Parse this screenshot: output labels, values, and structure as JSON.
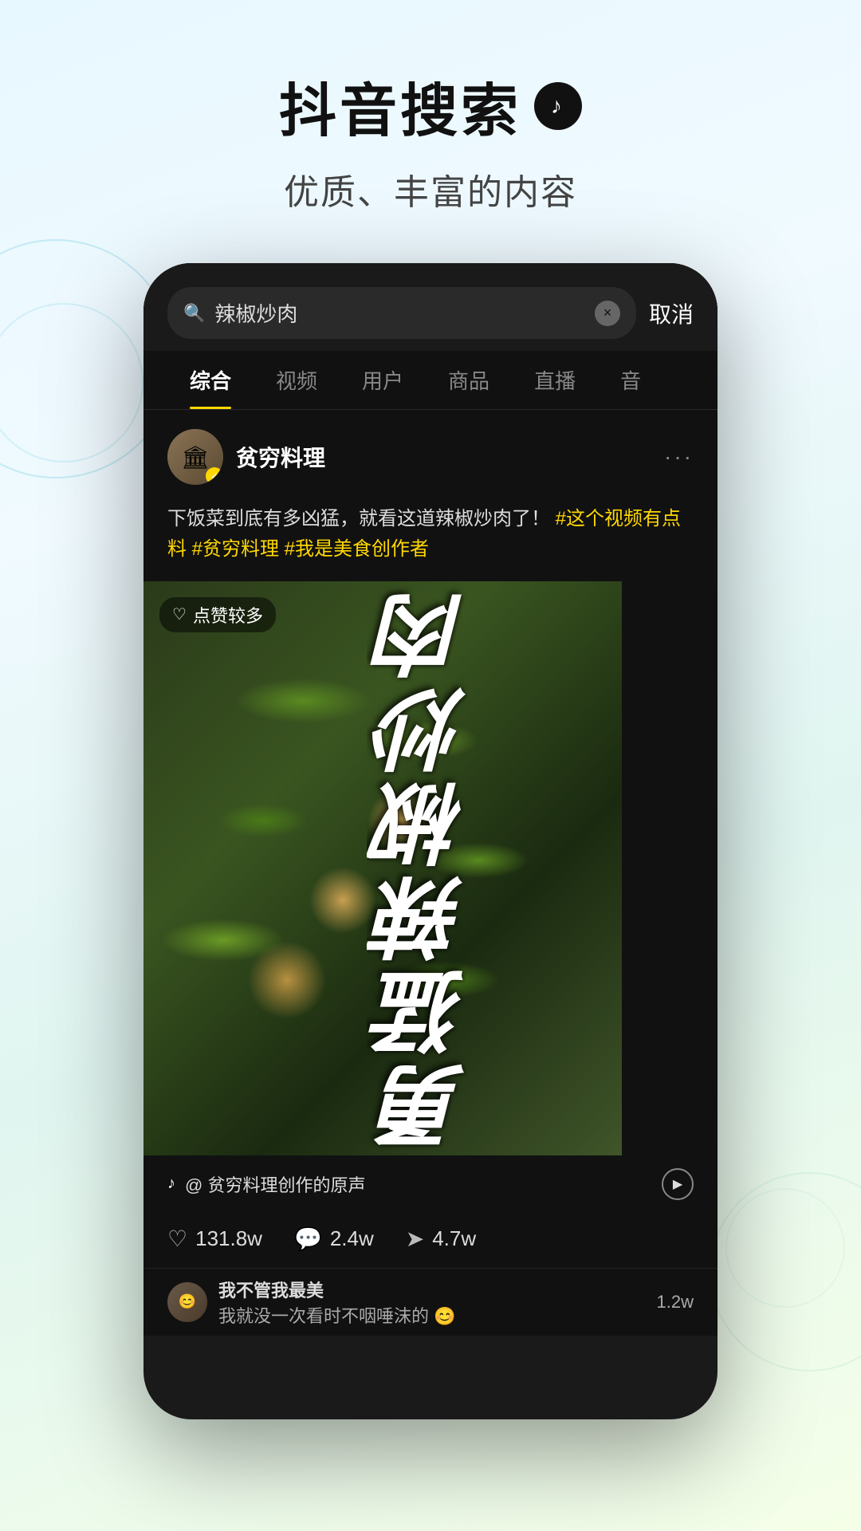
{
  "header": {
    "title": "抖音搜索",
    "logo_symbol": "♪",
    "subtitle": "优质、丰富的内容"
  },
  "phone": {
    "search": {
      "query": "辣椒炒肉",
      "cancel_label": "取消",
      "clear_symbol": "×",
      "search_symbol": "🔍"
    },
    "tabs": [
      {
        "label": "综合",
        "active": true
      },
      {
        "label": "视频",
        "active": false
      },
      {
        "label": "用户",
        "active": false
      },
      {
        "label": "商品",
        "active": false
      },
      {
        "label": "直播",
        "active": false
      },
      {
        "label": "音",
        "active": false
      }
    ],
    "post": {
      "author": {
        "name": "贫穷料理",
        "avatar_symbol": "🏛"
      },
      "more_dots": "···",
      "text": "下饭菜到底有多凶猛，就看这道辣椒炒肉了！",
      "tags": "#这个视频有点料 #贫穷料理 #我是美食创作者",
      "likes_badge": "点赞较多",
      "video_title": "勇猛辣椒炒肉",
      "music_info": "@ 贫穷料理创作的原声",
      "tiktok_icon": "♪",
      "play_icon": "▶"
    },
    "stats": {
      "likes": "131.8w",
      "comments": "2.4w",
      "shares": "4.7w",
      "like_icon": "♡",
      "comment_icon": "💬",
      "share_icon": "➤"
    },
    "comments": [
      {
        "author": "我不管我最美",
        "text": "我就没一次看时不咽唾沫的 😊",
        "likes": "1.2w",
        "avatar_symbol": "😊"
      }
    ]
  }
}
